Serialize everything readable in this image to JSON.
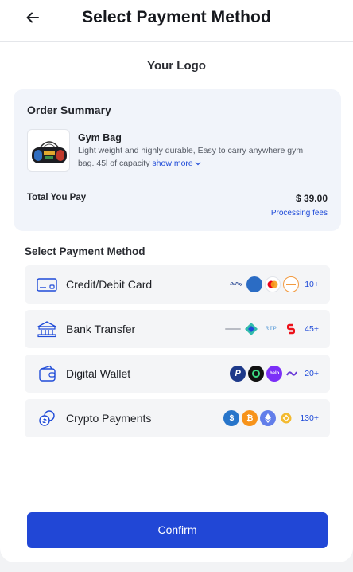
{
  "header": {
    "title": "Select Payment Method"
  },
  "brand": {
    "logo_text": "Your Logo"
  },
  "summary": {
    "title": "Order Summary",
    "product": {
      "name": "Gym Bag",
      "description": "Light weight and highly durable, Easy to carry anywhere gym bag. 45l of capacity",
      "show_more": "show more"
    },
    "total_label": "Total You Pay",
    "total_value": "$ 39.00",
    "fees_link": "Processing fees"
  },
  "payment": {
    "section_title": "Select Payment Method",
    "methods": [
      {
        "label": "Credit/Debit Card",
        "icon": "credit-card-icon",
        "more": "10+",
        "logos": [
          "rupay-logo",
          "amex-logo",
          "mastercard-logo",
          "discover-logo"
        ]
      },
      {
        "label": "Bank Transfer",
        "icon": "bank-icon",
        "more": "45+",
        "logos": [
          "eclear-logo",
          "pix-logo",
          "rtp-logo",
          "scotiabank-logo"
        ]
      },
      {
        "label": "Digital Wallet",
        "icon": "wallet-icon",
        "more": "20+",
        "logos": [
          "paypal-logo",
          "wallet-green-logo",
          "belo-logo",
          "wave-logo"
        ]
      },
      {
        "label": "Crypto Payments",
        "icon": "crypto-coins-icon",
        "more": "130+",
        "logos": [
          "usdc-logo",
          "bitcoin-logo",
          "ethereum-logo",
          "bnb-logo"
        ]
      }
    ]
  },
  "actions": {
    "confirm_label": "Confirm"
  },
  "colors": {
    "accent": "#2147d6",
    "link": "#1f4bd8",
    "summary_bg": "#f1f4fa",
    "row_bg": "#f4f5f7"
  }
}
